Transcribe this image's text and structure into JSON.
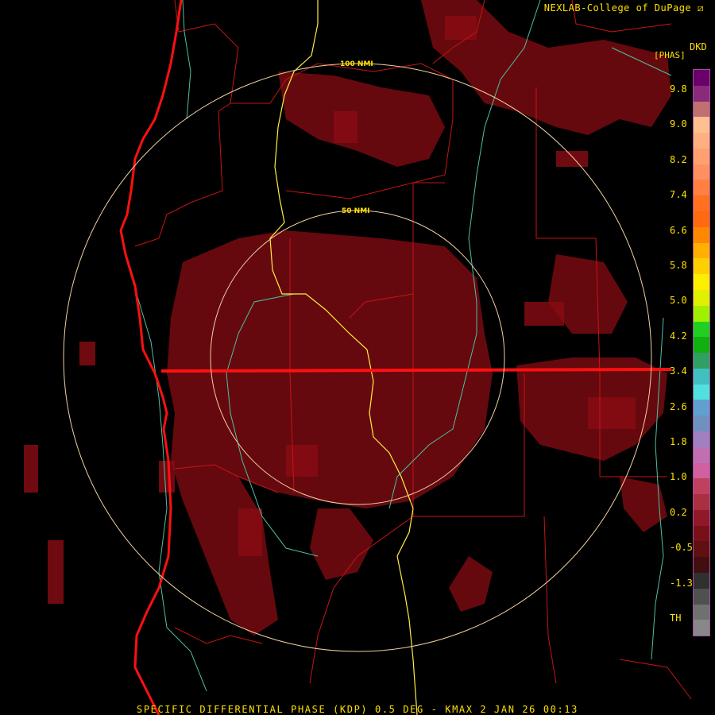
{
  "header": {
    "credit": "NEXLAB-College of DuPage ⧄"
  },
  "footer": {
    "product_line": "SPECIFIC DIFFERENTIAL PHASE (KDP) 0.5 DEG - KMAX 2 JAN 26 00:13"
  },
  "legend": {
    "units_code": "DKD",
    "units_name": "[PHAS]",
    "ticks": [
      "9.8",
      "9.0",
      "8.2",
      "7.4",
      "6.6",
      "5.8",
      "5.0",
      "4.2",
      "3.4",
      "2.6",
      "1.8",
      "1.0",
      "0.2",
      "-0.5",
      "-1.3",
      "TH"
    ],
    "colors": [
      "#6a006a",
      "#8a2a7a",
      "#c07070",
      "#ffc090",
      "#ffb080",
      "#ffa070",
      "#ff9060",
      "#ff8040",
      "#ff7020",
      "#ff6a10",
      "#ff8800",
      "#ffb000",
      "#ffd000",
      "#ffee00",
      "#e0f000",
      "#a0f000",
      "#20d020",
      "#10b010",
      "#30a060",
      "#40c0c0",
      "#50e0e0",
      "#60a0d0",
      "#7090c0",
      "#a080c0",
      "#c070b0",
      "#d060a0",
      "#c04060",
      "#a83040",
      "#901828",
      "#781018",
      "#601010",
      "#401010",
      "#303030",
      "#505050",
      "#707070",
      "#888888"
    ]
  },
  "rings": {
    "inner_label": "50 NMI",
    "outer_label": "100 NMI"
  },
  "colors": {
    "text": "#ffe000",
    "echo": "#7a0a10",
    "border": "#d01818",
    "coast": "#ff1010",
    "highway": "#ffee40",
    "river": "#4fc0a0",
    "range_ring": "#f0d0a0"
  }
}
